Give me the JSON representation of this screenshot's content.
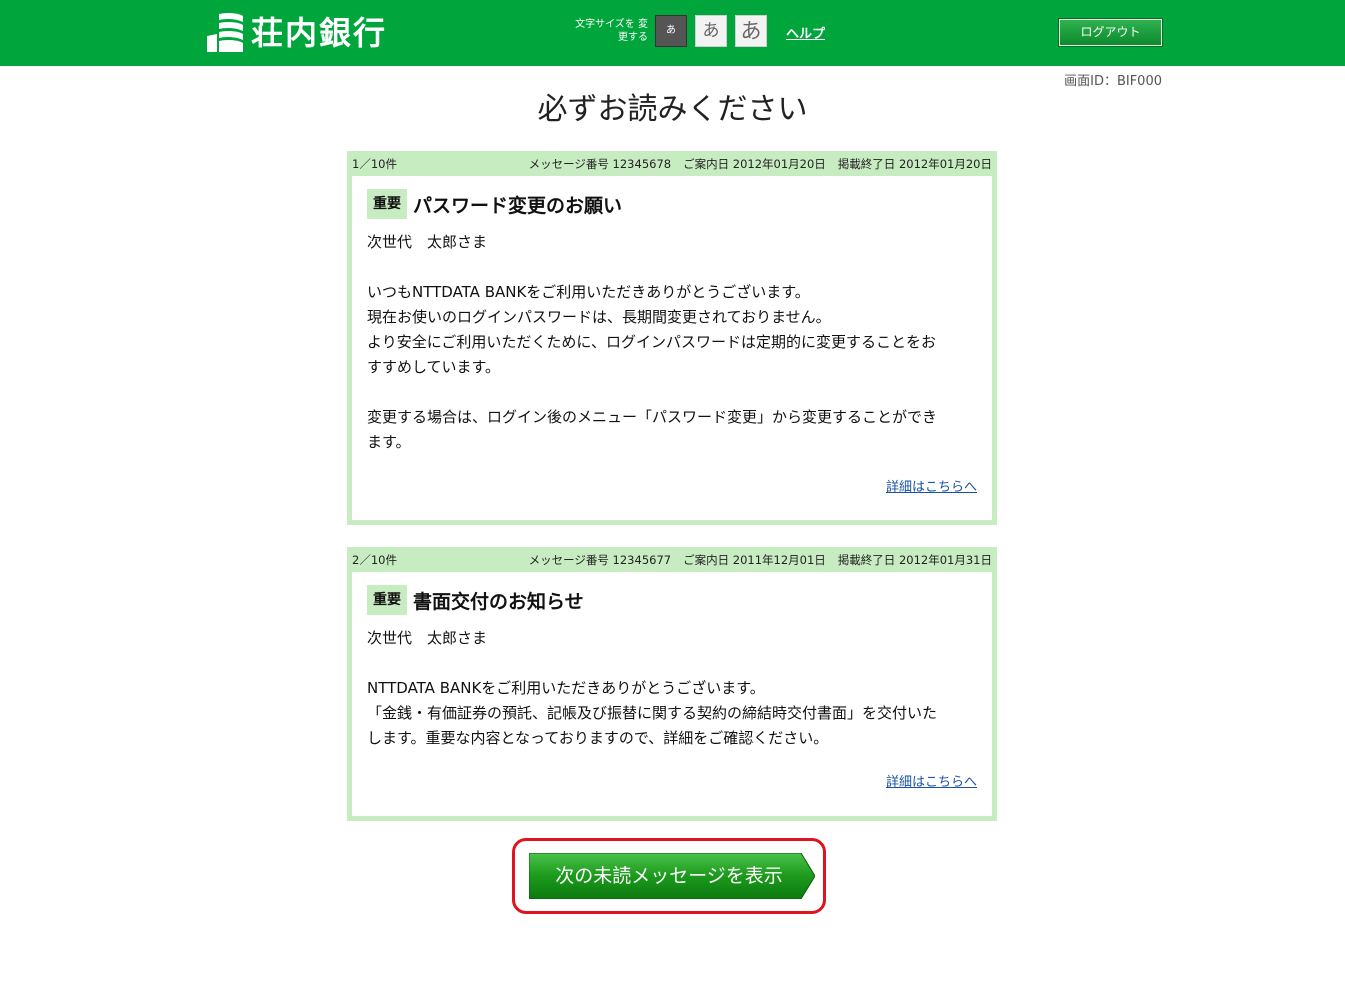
{
  "header": {
    "logo_text": "荘内銀行",
    "fontsize_label": "文字サイズを 変更する",
    "fontsize_small": "あ",
    "fontsize_mid": "あ",
    "fontsize_large": "あ",
    "help_label": "ヘルプ",
    "logout_label": "ログアウト"
  },
  "screen_id": "画面ID：BIF000",
  "page_title": "必ずお読みください",
  "messages": [
    {
      "count": "1／10件",
      "number": "メッセージ番号 12345678",
      "date": "ご案内日 2012年01月20日",
      "end_date": "掲載終了日 2012年01月20日",
      "badge": "重要",
      "title": "パスワード変更のお願い",
      "name": "次世代　太郎さま",
      "body": "いつもNTTDATA BANKをご利用いただきありがとうございます。\n現在お使いのログインパスワードは、長期間変更されておりません。\nより安全にご利用いただくために、ログインパスワードは定期的に変更することをお\nすすめしています。\n\n変更する場合は、ログイン後のメニュー「パスワード変更」から変更することができ\nます。",
      "detail_link": "詳細はこちらへ"
    },
    {
      "count": "2／10件",
      "number": "メッセージ番号 12345677",
      "date": "ご案内日 2011年12月01日",
      "end_date": "掲載終了日 2012年01月31日",
      "badge": "重要",
      "title": "書面交付のお知らせ",
      "name": "次世代　太郎さま",
      "body": "NTTDATA BANKをご利用いただきありがとうございます。\n「金銭・有価証券の預託、記帳及び振替に関する契約の締結時交付書面」を交付いた\nします。重要な内容となっておりますので、詳細をご確認ください。",
      "detail_link": "詳細はこちらへ"
    }
  ],
  "next_button": "次の未読メッセージを表示",
  "colors": {
    "header_green": "#00a63c",
    "message_border": "#c8ecc1",
    "link_blue": "#1a52a8",
    "highlight_red": "#e0141e"
  },
  "icons": [
    "bank-logo-icon"
  ]
}
